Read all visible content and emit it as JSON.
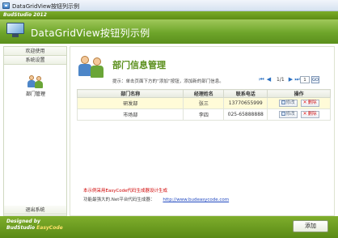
{
  "window": {
    "title": "DataGridView按钮列示例"
  },
  "brand": "BudStudio 2012",
  "header": {
    "title": "DataGridView按钮列示例"
  },
  "sidebar": {
    "links": [
      "欢迎使用",
      "系统设置"
    ],
    "entry_label": "部门管理",
    "exit_label": "退出系统"
  },
  "main": {
    "title": "部门信息管理",
    "hint": "提示：单击页面下方的“添加”按钮，添加新的部门信息。",
    "pager": {
      "info": "1/1",
      "page_value": "1",
      "go": "GO"
    },
    "columns": [
      "部门名称",
      "经理姓名",
      "联系电话",
      "操作"
    ],
    "rows": [
      {
        "name": "研发部",
        "manager": "张三",
        "phone": "13770655999",
        "edit": "修改",
        "delete": "删除"
      },
      {
        "name": "市场部",
        "manager": "李四",
        "phone": "025-65888888",
        "edit": "修改",
        "delete": "删除"
      }
    ],
    "note": "本示例采用EasyCode代码生成器设计生成",
    "platform_text": "功能最强大的.Net平台代码生成器：",
    "platform_link": "http://www.budeasycode.com"
  },
  "footer": {
    "designed_by": "Designed by",
    "studio": "BudStudio",
    "product": "EasyCode",
    "add_label": "添加"
  },
  "colors": {
    "accent_green": "#6ea52a",
    "title_green": "#5b8f1c",
    "note_red": "#d00000",
    "link_blue": "#2048c0"
  }
}
